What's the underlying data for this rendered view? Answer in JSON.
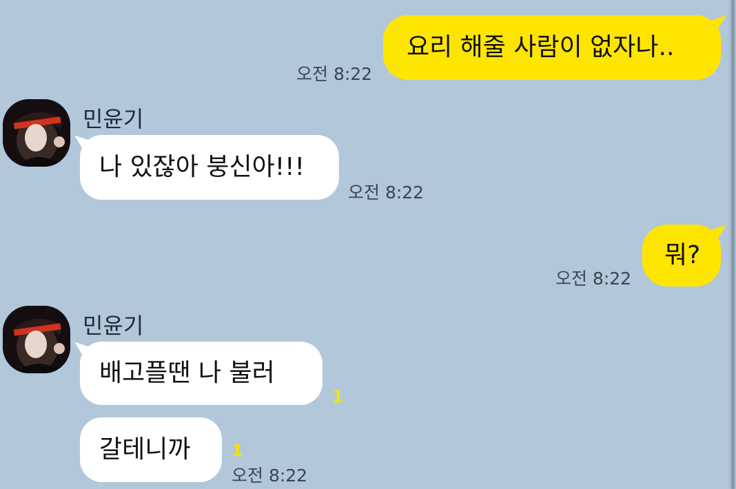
{
  "chat": {
    "messages": [
      {
        "side": "sent",
        "text": "요리 해줄 사람이 없자나..",
        "time": "오전 8:22"
      },
      {
        "side": "recv",
        "sender": "민윤기",
        "text": "나 있잖아 붕신아!!!",
        "time": "오전 8:22"
      },
      {
        "side": "sent",
        "text": "뭐?",
        "time": "오전 8:22"
      },
      {
        "side": "recv",
        "sender": "민윤기",
        "text": "배고플땐 나 불러",
        "unread": "1"
      },
      {
        "side": "recv",
        "text": "갈테니까",
        "unread": "1",
        "time": "오전 8:22"
      }
    ]
  },
  "colors": {
    "background": "#b2c7da",
    "sent_bubble": "#fee500",
    "recv_bubble": "#ffffff",
    "unread_count": "#f2e300"
  },
  "icons": {
    "avatar": "profile-photo"
  }
}
